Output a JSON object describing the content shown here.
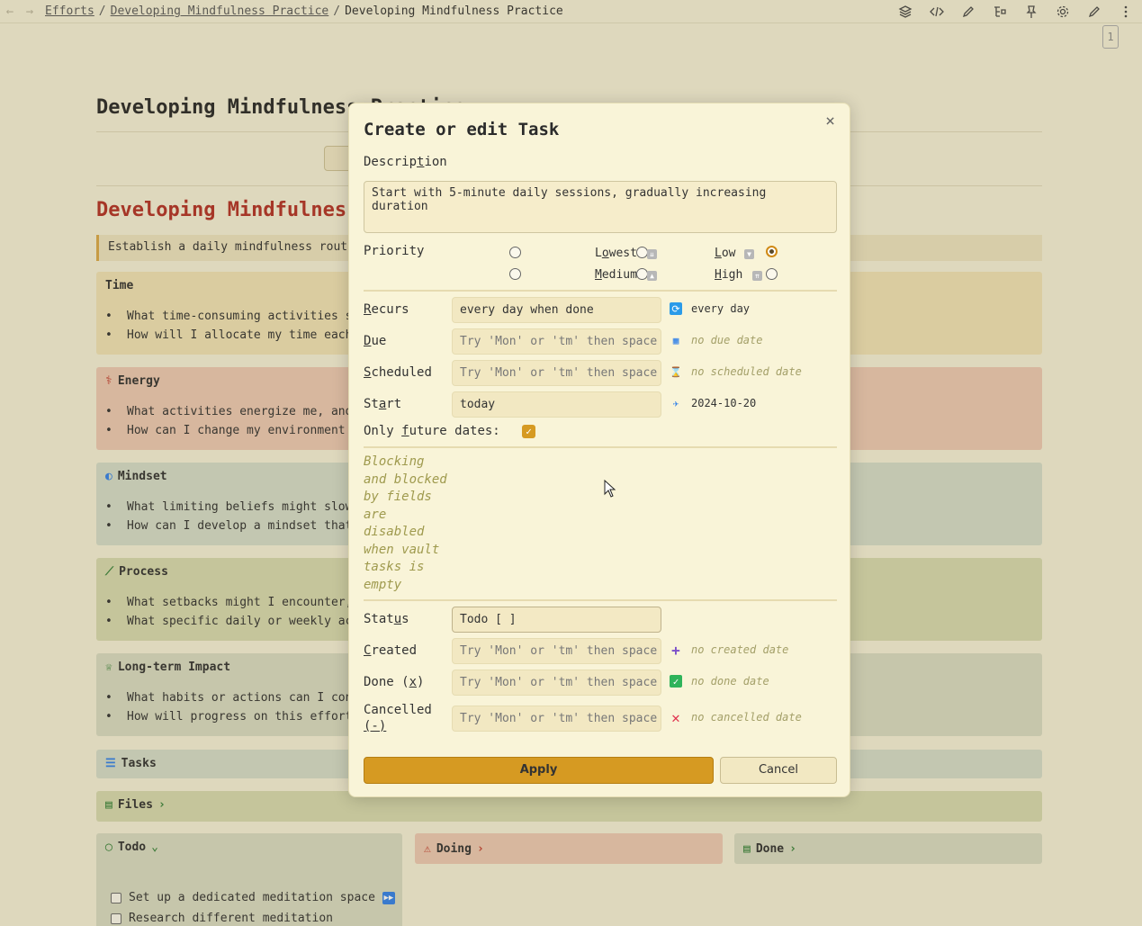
{
  "topbar": {
    "back_icon": "←",
    "forward_icon": "→",
    "crumbs": [
      "Efforts",
      "Developing Mindfulness Practice",
      "Developing Mindfulness Practice"
    ],
    "sep": "/",
    "page_num": "1"
  },
  "note": {
    "title": "Developing Mindfulness Practice",
    "heading": "Developing Mindfulness Practice",
    "quote": "Establish a daily mindfulness routine",
    "callouts": {
      "time": {
        "title": "Time",
        "items": [
          "What time-consuming activities s",
          "How will I allocate my time each"
        ]
      },
      "energy": {
        "title": "Energy",
        "items": [
          "What activities energize me, and",
          "How can I change my environment"
        ]
      },
      "mindset": {
        "title": "Mindset",
        "items": [
          "What limiting beliefs might slow",
          "How can I develop a mindset that"
        ]
      },
      "process": {
        "title": "Process",
        "items": [
          "What setbacks might I encounter,",
          "What specific daily or weekly ac"
        ]
      },
      "impact": {
        "title": "Long-term Impact",
        "items": [
          "What habits or actions can I con",
          "How will progress on this effort"
        ]
      }
    },
    "tasks_label": "Tasks",
    "files_label": "Files",
    "columns": {
      "todo": "Todo",
      "doing": "Doing",
      "done": "Done"
    },
    "todo_items": [
      "Set up a dedicated meditation space",
      "Research different meditation"
    ]
  },
  "modal": {
    "title": "Create or edit Task",
    "close": "×",
    "description_label": {
      "a": "Descrip",
      "u": "t",
      "b": "ion"
    },
    "description_value": "Start with 5-minute daily sessions, gradually increasing duration",
    "priority_label": "Priority",
    "priorities": {
      "lowest": {
        "a": "L",
        "u": "o",
        "b": "west"
      },
      "low": {
        "u": "L",
        "b": "ow"
      },
      "medium": {
        "u": "M",
        "b": "edium"
      },
      "high": {
        "u": "H",
        "b": "igh"
      }
    },
    "recurs": {
      "u": "R",
      "b": "ecurs",
      "value": "every day when done",
      "hint": "every day"
    },
    "due": {
      "u": "D",
      "b": "ue",
      "placeholder": "Try 'Mon' or 'tm' then space",
      "hint": "no due date"
    },
    "scheduled": {
      "u": "S",
      "b": "cheduled",
      "placeholder": "Try 'Mon' or 'tm' then space",
      "hint": "no scheduled date"
    },
    "start": {
      "a": "St",
      "u": "a",
      "b": "rt",
      "value": "today",
      "hint": "2024-10-20"
    },
    "future": {
      "a": "Only ",
      "u": "f",
      "b": "uture dates:"
    },
    "blocking_note": "Blocking and blocked by fields are disabled when vault tasks is empty",
    "status": {
      "a": "Stat",
      "u": "u",
      "b": "s",
      "value": "Todo [ ]"
    },
    "created": {
      "u": "C",
      "b": "reated",
      "placeholder": "Try 'Mon' or 'tm' then space",
      "hint": "no created date"
    },
    "done": {
      "a": "Done (",
      "u": "x",
      "b": ")",
      "placeholder": "Try 'Mon' or 'tm' then space",
      "hint": "no done date"
    },
    "cancelled": {
      "a": "Cancelled",
      "u": "(-)",
      "placeholder": "Try 'Mon' or 'tm' then space",
      "hint": "no cancelled date"
    },
    "apply": "Apply",
    "cancel": "Cancel"
  },
  "colors": {
    "accent": "#d69a22",
    "heading_red": "#b02a1f",
    "hint_olive": "#a39f68"
  }
}
